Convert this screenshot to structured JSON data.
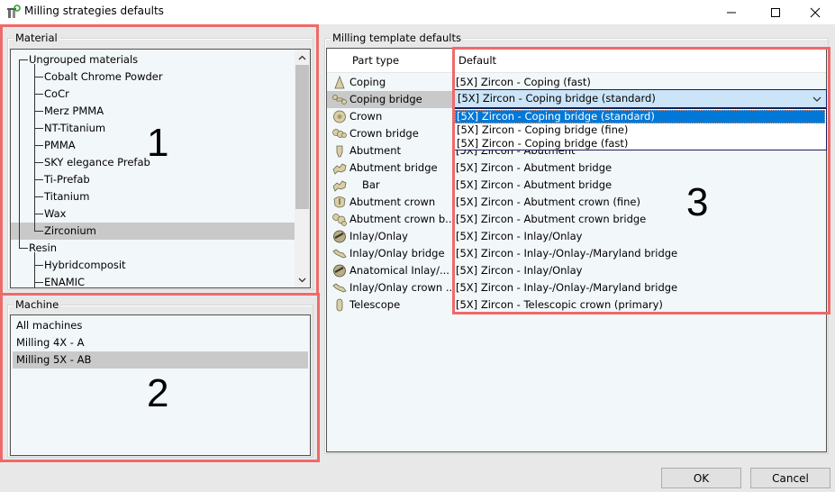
{
  "window": {
    "title": "Milling strategies defaults",
    "icon": "milling-tool-icon",
    "controls": {
      "minimize": "minimize-icon",
      "maximize": "maximize-icon",
      "close": "close-icon"
    }
  },
  "material": {
    "group_label": "Material",
    "tree": [
      {
        "label": "Ungrouped materials",
        "level": 0,
        "selected": false
      },
      {
        "label": "Cobalt Chrome Powder",
        "level": 1,
        "selected": false
      },
      {
        "label": "CoCr",
        "level": 1,
        "selected": false
      },
      {
        "label": "Merz PMMA",
        "level": 1,
        "selected": false
      },
      {
        "label": "NT-Titanium",
        "level": 1,
        "selected": false
      },
      {
        "label": "PMMA",
        "level": 1,
        "selected": false
      },
      {
        "label": "SKY elegance Prefab",
        "level": 1,
        "selected": false
      },
      {
        "label": "Ti-Prefab",
        "level": 1,
        "selected": false
      },
      {
        "label": "Titanium",
        "level": 1,
        "selected": false
      },
      {
        "label": "Wax",
        "level": 1,
        "selected": false
      },
      {
        "label": "Zirconium",
        "level": 1,
        "selected": true
      },
      {
        "label": "Resin",
        "level": 0,
        "selected": false
      },
      {
        "label": "Hybridcomposit",
        "level": 1,
        "selected": false
      },
      {
        "label": "ENAMIC",
        "level": 1,
        "selected": false
      }
    ],
    "annotation": "1"
  },
  "machine": {
    "group_label": "Machine",
    "items": [
      {
        "label": "All machines",
        "selected": false
      },
      {
        "label": "Milling 4X - A",
        "selected": false
      },
      {
        "label": "Milling 5X - AB",
        "selected": true
      }
    ],
    "annotation": "2"
  },
  "templates": {
    "group_label": "Milling template defaults",
    "columns": {
      "part_type": "Part type",
      "default": "Default"
    },
    "rows": [
      {
        "part_type": "Coping",
        "icon": "coping-icon",
        "default": "[5X] Zircon - Coping (fast)",
        "selected": false
      },
      {
        "part_type": "Coping bridge",
        "icon": "coping-bridge-icon",
        "default": "[5X] Zircon - Coping bridge (standard)",
        "selected": true
      },
      {
        "part_type": "Crown",
        "icon": "crown-icon",
        "default": "",
        "selected": false
      },
      {
        "part_type": "Crown bridge",
        "icon": "crown-bridge-icon",
        "default": "",
        "selected": false
      },
      {
        "part_type": "Abutment",
        "icon": "abutment-icon",
        "default": "[5X] Zircon - Abutment",
        "selected": false
      },
      {
        "part_type": "Abutment bridge",
        "icon": "abutment-bridge-icon",
        "default": "[5X] Zircon - Abutment bridge",
        "selected": false
      },
      {
        "part_type": "Bar",
        "icon": "bar-icon",
        "default": "[5X] Zircon - Abutment bridge",
        "selected": false
      },
      {
        "part_type": "Abutment crown",
        "icon": "abutment-crown-icon",
        "default": "[5X] Zircon - Abutment crown (fine)",
        "selected": false
      },
      {
        "part_type": "Abutment crown b...",
        "icon": "abutment-crown-bridge-icon",
        "default": "[5X] Zircon - Abutment crown bridge",
        "selected": false
      },
      {
        "part_type": "Inlay/Onlay",
        "icon": "inlay-onlay-icon",
        "default": "[5X] Zircon - Inlay/Onlay",
        "selected": false
      },
      {
        "part_type": "Inlay/Onlay bridge",
        "icon": "inlay-onlay-bridge-icon",
        "default": "[5X] Zircon - Inlay-/Onlay-/Maryland bridge",
        "selected": false
      },
      {
        "part_type": "Anatomical Inlay/...",
        "icon": "anatomical-inlay-icon",
        "default": "[5X] Zircon - Inlay/Onlay",
        "selected": false
      },
      {
        "part_type": "Inlay/Onlay crown ...",
        "icon": "inlay-onlay-crown-icon",
        "default": "[5X] Zircon - Inlay-/Onlay-/Maryland bridge",
        "selected": false
      },
      {
        "part_type": "Telescope",
        "icon": "telescope-icon",
        "default": "[5X] Zircon - Telescopic crown (primary)",
        "selected": false
      }
    ],
    "combo": {
      "value": "[5X] Zircon - Coping bridge (standard)",
      "options": [
        {
          "label": "[5X] Zircon - Coping bridge (standard)",
          "highlighted": true
        },
        {
          "label": "[5X] Zircon - Coping bridge (fine)",
          "highlighted": false
        },
        {
          "label": "[5X] Zircon - Coping bridge (fast)",
          "highlighted": false
        }
      ]
    },
    "annotation": "3"
  },
  "buttons": {
    "ok": "OK",
    "cancel": "Cancel"
  },
  "colors": {
    "annotation_border": "#ee6a6a",
    "selection_gray": "#c9c9c9",
    "combo_bg": "#cce4f7",
    "dropdown_highlight": "#0078d7",
    "list_bg": "#f2f7fa",
    "dialog_bg": "#e8e8e9"
  }
}
